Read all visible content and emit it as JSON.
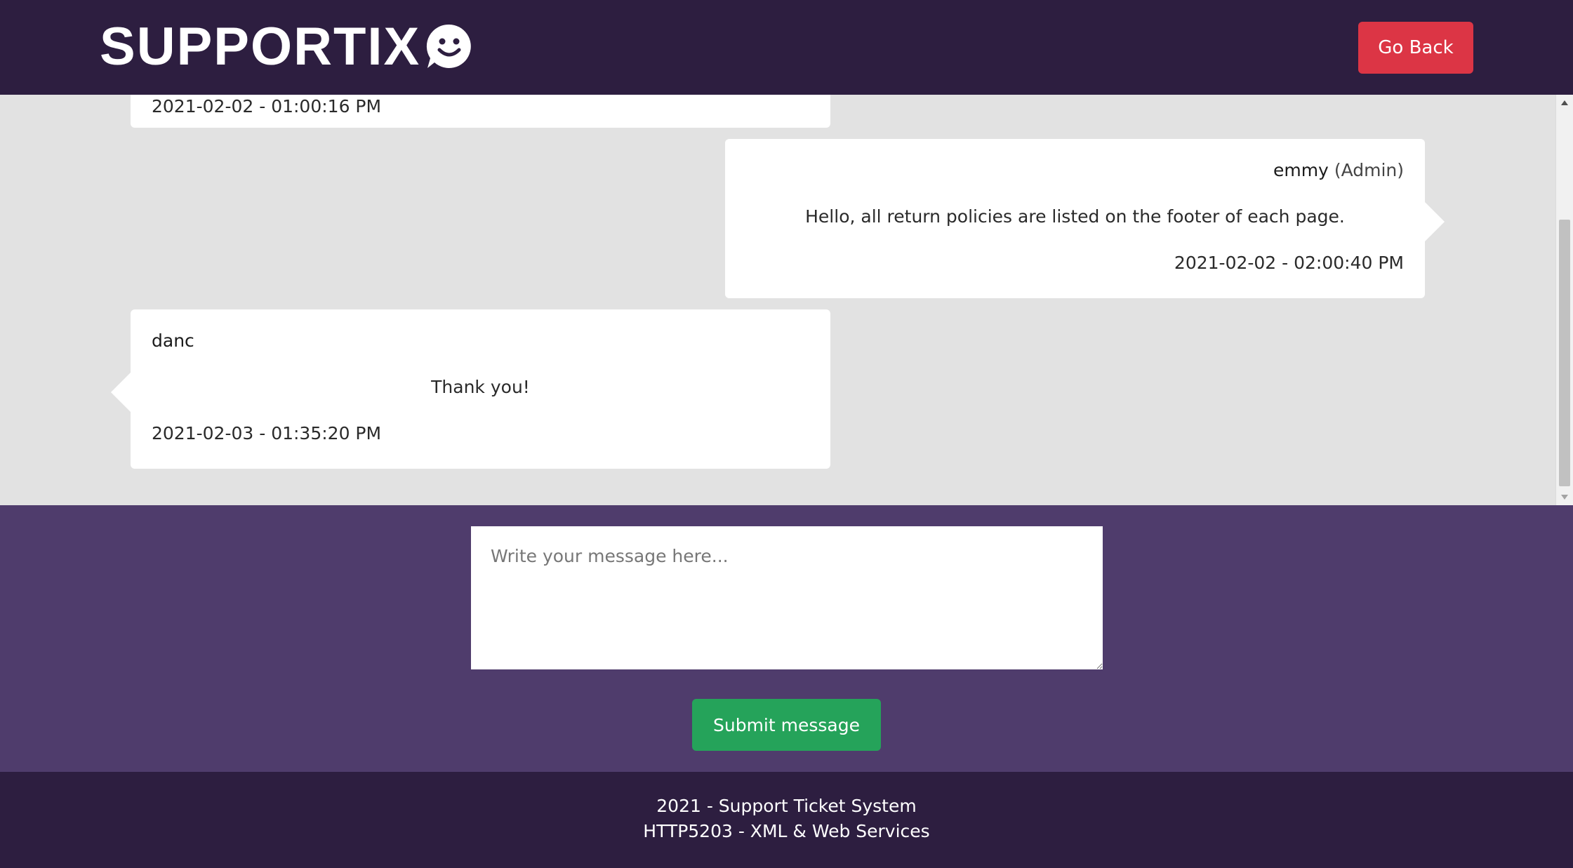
{
  "header": {
    "logo_text": "SUPPORTIX",
    "go_back_label": "Go Back"
  },
  "messages": [
    {
      "author": "",
      "role": "",
      "text": "",
      "timestamp": "2021-02-02 - 01:00:16 PM",
      "side": "left"
    },
    {
      "author": "emmy",
      "role": "(Admin)",
      "text": "Hello, all return policies are listed on the footer of each page.",
      "timestamp": "2021-02-02 - 02:00:40 PM",
      "side": "right"
    },
    {
      "author": "danc",
      "role": "",
      "text": "Thank you!",
      "timestamp": "2021-02-03 - 01:35:20 PM",
      "side": "left"
    }
  ],
  "compose": {
    "placeholder": "Write your message here...",
    "value": "",
    "submit_label": "Submit message"
  },
  "footer": {
    "line1": "2021 - Support Ticket System",
    "line2": "HTTP5203 - XML & Web Services"
  },
  "colors": {
    "header_bg": "#2d1e40",
    "compose_bg": "#4f3c6c",
    "go_back": "#dc3545",
    "submit": "#25a35a",
    "chat_bg": "#e2e2e2"
  }
}
